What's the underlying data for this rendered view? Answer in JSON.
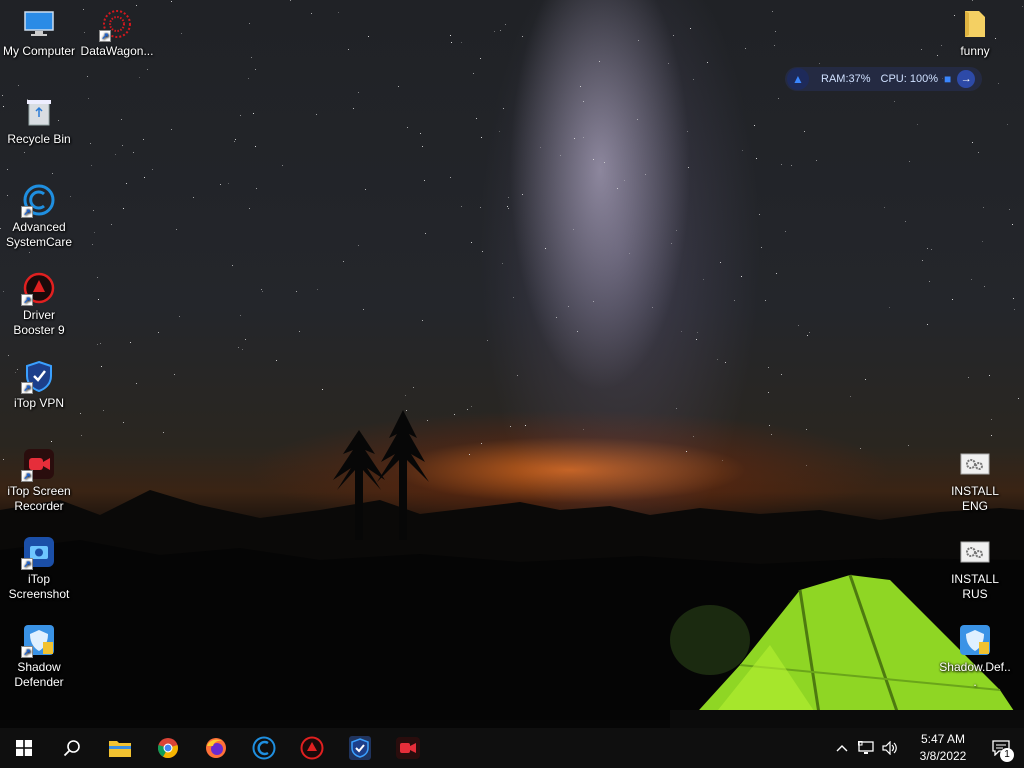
{
  "desktop": {
    "left_icons": [
      {
        "label": "My Computer",
        "icon": "computer-icon",
        "shortcut": false
      },
      {
        "label": "DataWagon...",
        "icon": "datawagon-icon",
        "shortcut": true
      },
      {
        "label": "Recycle Bin",
        "icon": "recycle-bin-icon",
        "shortcut": false
      },
      {
        "label": "Advanced SystemCare",
        "icon": "advanced-systemcare-icon",
        "shortcut": true
      },
      {
        "label": "Driver Booster 9",
        "icon": "driver-booster-icon",
        "shortcut": true
      },
      {
        "label": "iTop VPN",
        "icon": "itop-vpn-icon",
        "shortcut": true
      },
      {
        "label": "iTop Screen Recorder",
        "icon": "itop-screen-recorder-icon",
        "shortcut": true
      },
      {
        "label": "iTop Screenshot",
        "icon": "itop-screenshot-icon",
        "shortcut": true
      },
      {
        "label": "Shadow Defender",
        "icon": "shadow-defender-icon",
        "shortcut": true
      }
    ],
    "right_icons": [
      {
        "label": "funny",
        "icon": "folder-icon"
      },
      {
        "label": "INSTALL ENG",
        "icon": "batch-file-icon"
      },
      {
        "label": "INSTALL RUS",
        "icon": "batch-file-icon"
      },
      {
        "label": "Shadow.Def...",
        "icon": "shadow-defender-icon"
      }
    ]
  },
  "widget": {
    "ram": "RAM:37%",
    "cpu": "CPU: 100%"
  },
  "taskbar": {
    "apps": [
      {
        "name": "start",
        "icon": "windows-logo-icon"
      },
      {
        "name": "search",
        "icon": "search-icon"
      },
      {
        "name": "file-explorer",
        "icon": "file-explorer-icon"
      },
      {
        "name": "chrome",
        "icon": "chrome-icon"
      },
      {
        "name": "firefox",
        "icon": "firefox-icon"
      },
      {
        "name": "advanced-systemcare",
        "icon": "advanced-systemcare-icon"
      },
      {
        "name": "driver-booster",
        "icon": "driver-booster-icon"
      },
      {
        "name": "itop-vpn",
        "icon": "itop-vpn-icon"
      },
      {
        "name": "itop-screen-recorder",
        "icon": "itop-screen-recorder-icon"
      }
    ],
    "time": "5:47 AM",
    "date": "3/8/2022",
    "notification_count": "1"
  }
}
